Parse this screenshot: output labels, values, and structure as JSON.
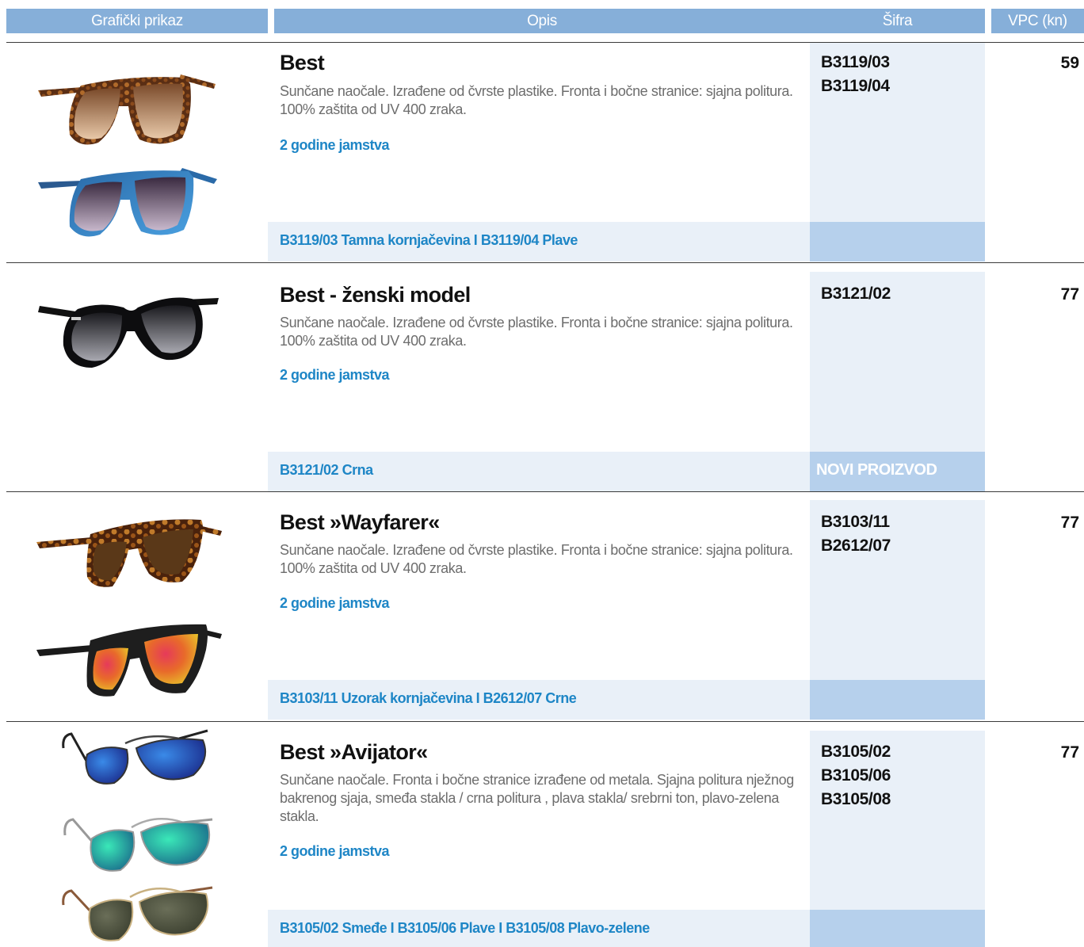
{
  "header": {
    "col_graphic": "Grafički prikaz",
    "col_description": "Opis",
    "col_code": "Šifra",
    "col_price": "VPC (kn)"
  },
  "products": [
    {
      "title": "Best",
      "description": "Sunčane naočale. Izrađene od čvrste plastike. Fronta i bočne stranice: sjajna politura. 100% zaštita od UV 400 zraka.",
      "warranty": "2 godine jamstva",
      "variants_line": "B3119/03 Tamna kornjačevina I B3119/04 Plave",
      "codes": [
        "B3119/03",
        "B3119/04"
      ],
      "price": "59",
      "badge": "",
      "images": [
        "tortoise-wayfarer-brown-lens",
        "blue-frame-gradient-lens"
      ]
    },
    {
      "title": "Best - ženski model",
      "description": "Sunčane naočale. Izrađene od čvrste plastike. Fronta i bočne stranice: sjajna politura. 100% zaštita od UV 400 zraka.",
      "warranty": "2 godine jamstva",
      "variants_line": "B3121/02 Crna",
      "codes": [
        "B3121/02"
      ],
      "price": "77",
      "badge": "NOVI PROIZVOD",
      "images": [
        "black-cat-eye-gradient-lens"
      ]
    },
    {
      "title": "Best »Wayfarer«",
      "description": "Sunčane naočale. Izrađene od čvrste plastike. Fronta i bočne stranice: sjajna politura. 100% zaštita od UV 400 zraka.",
      "warranty": "2 godine jamstva",
      "variants_line": "B3103/11 Uzorak kornjačevina I B2612/07 Crne",
      "codes": [
        "B3103/11",
        "B2612/07"
      ],
      "price": "77",
      "badge": "",
      "images": [
        "tortoise-wayfarer-brown-lens",
        "black-wayfarer-mirror-lens"
      ]
    },
    {
      "title": "Best »Avijator«",
      "description": "Sunčane naočale. Fronta i bočne stranice izrađene od metala. Sjajna politura nježnog bakrenog sjaja, smeđa stakla / crna politura , plava stakla/ srebrni ton, plavo-zelena stakla.",
      "warranty": "2 godine jamstva",
      "variants_line": "B3105/02 Smeđe I B3105/06 Plave I B3105/08 Plavo-zelene",
      "codes": [
        "B3105/02",
        "B3105/06",
        "B3105/08"
      ],
      "price": "77",
      "badge": "",
      "images": [
        "aviator-blue-mirror",
        "aviator-green-mirror",
        "aviator-olive-lens"
      ]
    }
  ],
  "colors": {
    "header_bg": "#86afd9",
    "accent_blue": "#1e86c6",
    "light_panel": "#e9f0f8",
    "badge_bg": "#b6d0ec"
  }
}
